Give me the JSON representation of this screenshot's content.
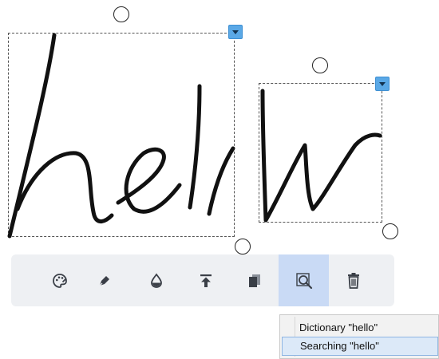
{
  "ink": {
    "objects": [
      {
        "name": "ink-group-hel"
      },
      {
        "name": "ink-group-lo"
      }
    ]
  },
  "toolbar": {
    "items": [
      {
        "name": "palette-icon",
        "label": ""
      },
      {
        "name": "pen-icon",
        "label": ""
      },
      {
        "name": "drop-icon",
        "label": ""
      },
      {
        "name": "bring-to-front-icon",
        "label": ""
      },
      {
        "name": "copy-icon",
        "label": ""
      },
      {
        "name": "search-icon",
        "label": "",
        "active": true
      },
      {
        "name": "trash-icon",
        "label": ""
      }
    ]
  },
  "context_menu": {
    "items": [
      {
        "label": "Dictionary \"hello\""
      },
      {
        "label": "Searching \"hello\"",
        "highlighted": true
      }
    ]
  },
  "colors": {
    "accent": "#5aa8e6",
    "toolbar_bg": "#eef0f3",
    "active_tool": "#c9daf5",
    "ink": "#111111"
  }
}
